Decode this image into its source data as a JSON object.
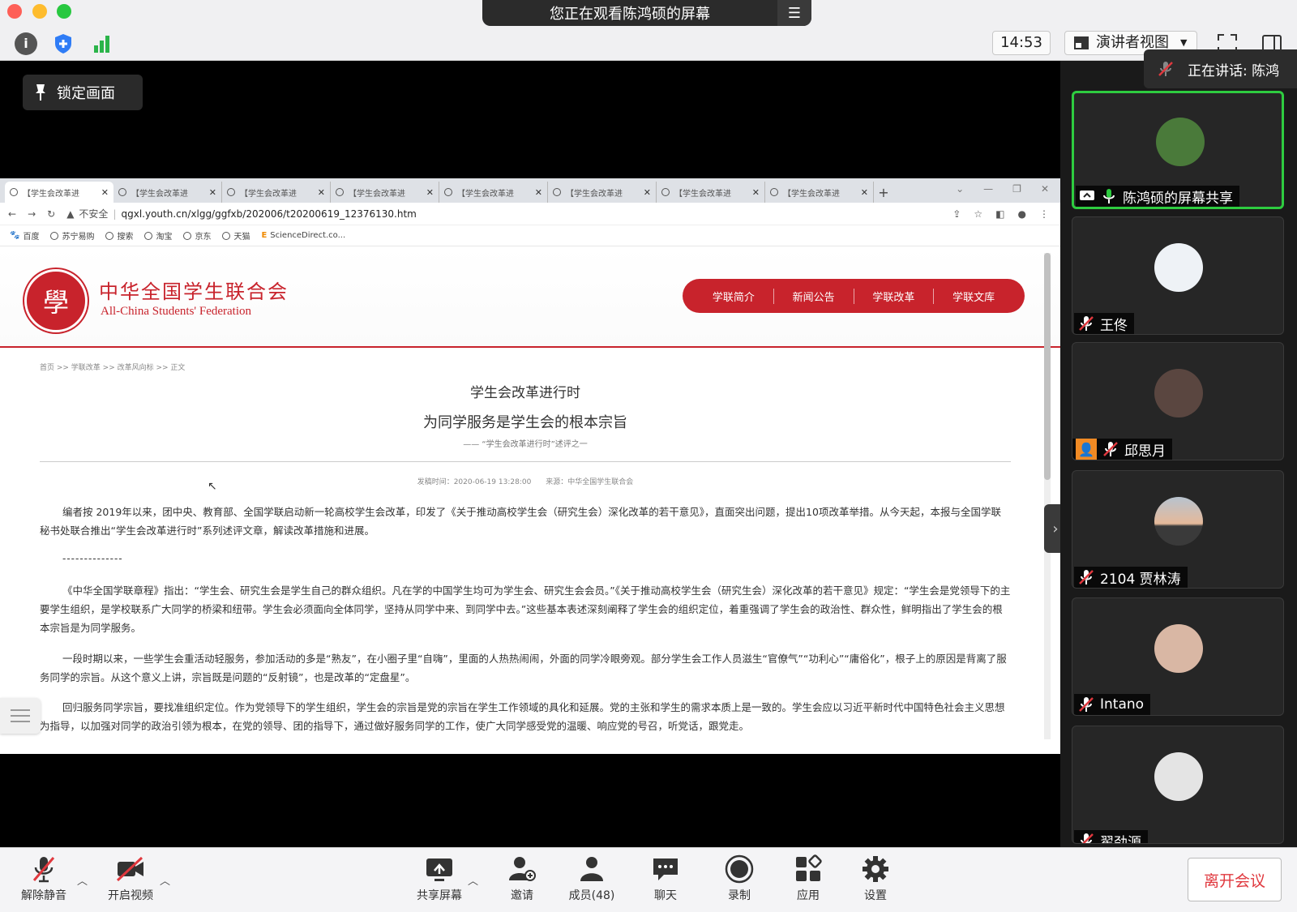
{
  "window": {
    "viewing_banner": "您正在观看陈鸿硕的屏幕",
    "clock": "14:53",
    "view_mode": "演讲者视图"
  },
  "share": {
    "lock_label": "锁定画面"
  },
  "browser": {
    "tabs": [
      {
        "title": "【学生会改革进"
      },
      {
        "title": "【学生会改革进"
      },
      {
        "title": "【学生会改革进"
      },
      {
        "title": "【学生会改革进"
      },
      {
        "title": "【学生会改革进"
      },
      {
        "title": "【学生会改革进"
      },
      {
        "title": "【学生会改革进"
      },
      {
        "title": "【学生会改革进"
      }
    ],
    "security_label": "不安全",
    "url": "qgxl.youth.cn/xlgg/ggfxb/202006/t20200619_12376130.htm",
    "bookmarks": [
      {
        "label": "百度"
      },
      {
        "label": "苏宁易购"
      },
      {
        "label": "搜索"
      },
      {
        "label": "淘宝"
      },
      {
        "label": "京东"
      },
      {
        "label": "天猫"
      },
      {
        "label": "ScienceDirect.co..."
      }
    ]
  },
  "site": {
    "logo_glyph": "學",
    "name_cn": "中华全国学生联合会",
    "name_en": "All-China Students' Federation",
    "nav": [
      "学联简介",
      "新闻公告",
      "学联改革",
      "学联文库"
    ],
    "breadcrumb": "首页 >> 学联改革 >> 改革风向标 >> 正文",
    "title": "学生会改革进行时",
    "subtitle": "为同学服务是学生会的根本宗旨",
    "series": "—— “学生会改革进行时”述评之一",
    "meta": "发稿时间：2020-06-19 13:28:00　　来源：中华全国学生联合会",
    "para1": "编者按 2019年以来，团中央、教育部、全国学联启动新一轮高校学生会改革，印发了《关于推动高校学生会（研究生会）深化改革的若干意见》，直面突出问题，提出10项改革举措。从今天起，本报与全国学联秘书处联合推出“学生会改革进行时”系列述评文章，解读改革措施和进展。",
    "dashes": "--------------",
    "para2": "《中华全国学联章程》指出：“学生会、研究生会是学生自己的群众组织。凡在学的中国学生均可为学生会、研究生会会员。”《关于推动高校学生会（研究生会）深化改革的若干意见》规定：“学生会是党领导下的主要学生组织，是学校联系广大同学的桥梁和纽带。学生会必须面向全体同学，坚持从同学中来、到同学中去。”这些基本表述深刻阐释了学生会的组织定位，着重强调了学生会的政治性、群众性，鲜明指出了学生会的根本宗旨是为同学服务。",
    "para3": "一段时期以来，一些学生会重活动轻服务，参加活动的多是“熟友”，在小圈子里“自嗨”，里面的人热热闹闹，外面的同学冷眼旁观。部分学生会工作人员滋生“官僚气”“功利心”“庸俗化”，根子上的原因是背离了服务同学的宗旨。从这个意义上讲，宗旨既是问题的“反射镜”，也是改革的“定盘星”。",
    "para4": "回归服务同学宗旨，要找准组织定位。作为党领导下的学生组织，学生会的宗旨是党的宗旨在学生工作领域的具化和延展。党的主张和学生的需求本质上是一致的。学生会应以习近平新时代中国特色社会主义思想为指导，以加强对同学的政治引领为根本，在党的领导、团的指导下，通过做好服务同学的工作，使广大同学感受党的温暖、响应党的号召，听党话，跟党走。"
  },
  "gallery": {
    "speaking_label": "正在讲话: 陈鸿",
    "participants": [
      {
        "name": "陈鸿硕的屏幕共享"
      },
      {
        "name": "王佟"
      },
      {
        "name": "邱思月"
      },
      {
        "name": "2104 贾林涛"
      },
      {
        "name": "Intano"
      },
      {
        "name": "翟劲源"
      }
    ]
  },
  "toolbar": {
    "unmute": "解除静音",
    "video": "开启视频",
    "share": "共享屏幕",
    "invite": "邀请",
    "members": "成员(48)",
    "chat": "聊天",
    "record": "录制",
    "apps": "应用",
    "settings": "设置",
    "leave": "离开会议"
  },
  "colors": {
    "accent_red": "#c8232c",
    "active_speaker": "#2ecc40",
    "leave_red": "#e0383e"
  }
}
